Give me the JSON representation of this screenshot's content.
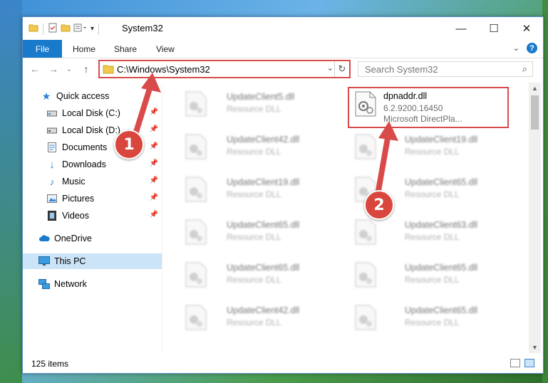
{
  "window": {
    "title": "System32"
  },
  "ribbon": {
    "file": "File",
    "home": "Home",
    "share": "Share",
    "view": "View",
    "help": "?"
  },
  "address": {
    "path": "C:\\Windows\\System32"
  },
  "search": {
    "placeholder": "Search System32"
  },
  "sidebar": {
    "quick_access": "Quick access",
    "items": [
      {
        "label": "Local Disk (C:)",
        "icon": "drive-icon"
      },
      {
        "label": "Local Disk (D:)",
        "icon": "drive-icon"
      },
      {
        "label": "Documents",
        "icon": "documents-icon"
      },
      {
        "label": "Downloads",
        "icon": "downloads-icon"
      },
      {
        "label": "Music",
        "icon": "music-icon"
      },
      {
        "label": "Pictures",
        "icon": "pictures-icon"
      },
      {
        "label": "Videos",
        "icon": "videos-icon"
      }
    ],
    "onedrive": "OneDrive",
    "this_pc": "This PC",
    "network": "Network"
  },
  "files": {
    "highlighted": {
      "name": "dpnaddr.dll",
      "version": "6.2.9200.16450",
      "description": "Microsoft DirectPla..."
    },
    "left_column": [
      {
        "name": "UpdateClient5.dll",
        "type": "Resource DLL"
      },
      {
        "name": "UpdateClient42.dll",
        "type": "Resource DLL"
      },
      {
        "name": "UpdateClient19.dll",
        "type": "Resource DLL"
      },
      {
        "name": "UpdateClient65.dll",
        "type": "Resource DLL"
      },
      {
        "name": "UpdateClient65.dll",
        "type": "Resource DLL"
      },
      {
        "name": "UpdateClient42.dll",
        "type": "Resource DLL"
      }
    ],
    "right_column": [
      {
        "name": "UpdateClient19.dll",
        "type": "Resource DLL"
      },
      {
        "name": "UpdateClient65.dll",
        "type": "Resource DLL"
      },
      {
        "name": "UpdateClient63.dll",
        "type": "Resource DLL"
      },
      {
        "name": "UpdateClient65.dll",
        "type": "Resource DLL"
      },
      {
        "name": "UpdateClient65.dll",
        "type": "Resource DLL"
      }
    ]
  },
  "status": {
    "count": "125 items"
  },
  "callouts": {
    "one": "1",
    "two": "2"
  },
  "colors": {
    "accent": "#1979ca",
    "callout": "#d94b4b",
    "selected": "#cce4f7"
  }
}
